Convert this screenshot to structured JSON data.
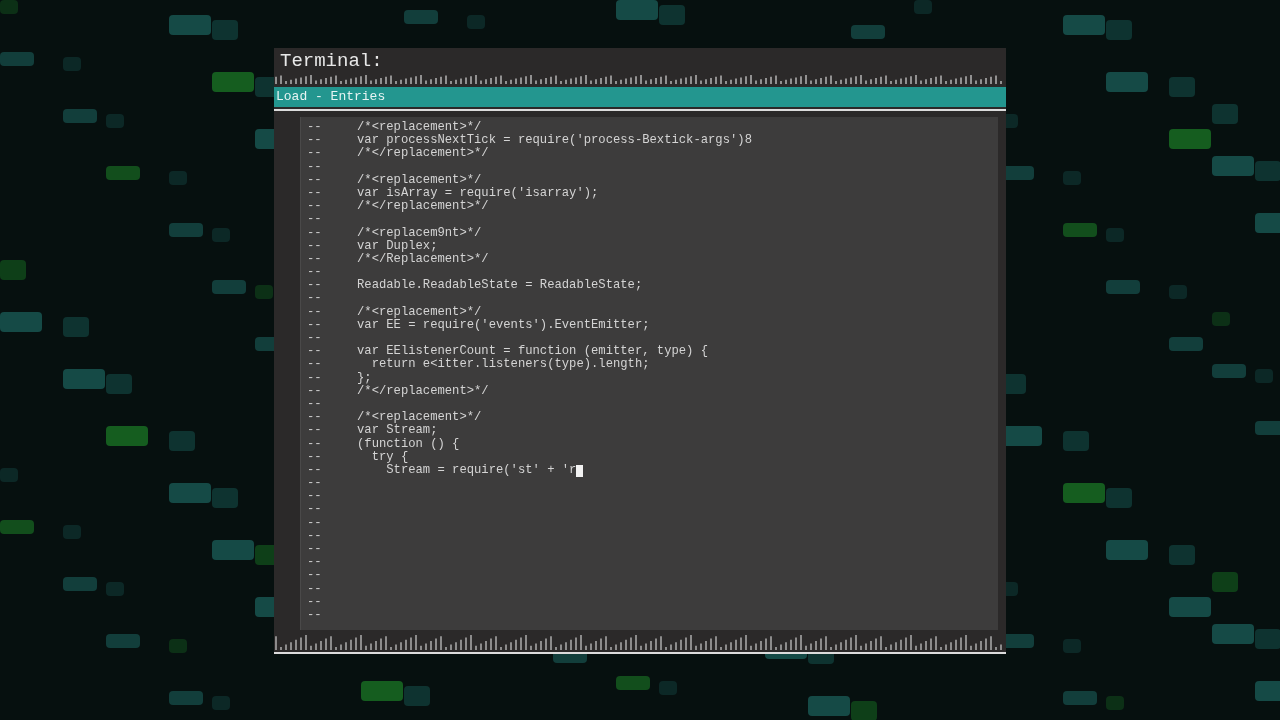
{
  "window": {
    "title": "Terminal:"
  },
  "header_bar": {
    "label": "Load - Entries"
  },
  "editor": {
    "lines": [
      {
        "marker": "--",
        "code": "/*<replacement>*/",
        "cursor": false
      },
      {
        "marker": "--",
        "code": "var processNextTick = require('process-Bextick-args')8",
        "cursor": false
      },
      {
        "marker": "--",
        "code": "/*</replacement>*/",
        "cursor": false
      },
      {
        "marker": "--",
        "cursor": false
      },
      {
        "marker": "--",
        "code": "/*<replacement>*/",
        "cursor": false
      },
      {
        "marker": "--",
        "code": "var isArray = require('isarray');",
        "cursor": false
      },
      {
        "marker": "--",
        "code": "/*</replacement>*/",
        "cursor": false
      },
      {
        "marker": "--",
        "cursor": false
      },
      {
        "marker": "--",
        "code": "/*<replacem9nt>*/",
        "cursor": false
      },
      {
        "marker": "--",
        "code": "var Duplex;",
        "cursor": false
      },
      {
        "marker": "--",
        "code": "/*</Replacement>*/",
        "cursor": false
      },
      {
        "marker": "--",
        "cursor": false
      },
      {
        "marker": "--",
        "code": "Readable.ReadableState = ReadableState;",
        "cursor": false
      },
      {
        "marker": "--",
        "cursor": false
      },
      {
        "marker": "--",
        "code": "/*<replacement>*/",
        "cursor": false
      },
      {
        "marker": "--",
        "code": "var EE = require('events').EventEmitter;",
        "cursor": false
      },
      {
        "marker": "--",
        "cursor": false
      },
      {
        "marker": "--",
        "code": "var EElistenerCount = function (emitter, type) {",
        "cursor": false
      },
      {
        "marker": "--",
        "code": "  return e<itter.listeners(type).length;",
        "cursor": false
      },
      {
        "marker": "--",
        "code": "};",
        "cursor": false
      },
      {
        "marker": "--",
        "code": "/*</replacement>*/",
        "cursor": false
      },
      {
        "marker": "--",
        "cursor": false
      },
      {
        "marker": "--",
        "code": "/*<replacement>*/",
        "cursor": false
      },
      {
        "marker": "--",
        "code": "var Stream;",
        "cursor": false
      },
      {
        "marker": "--",
        "code": "(function () {",
        "cursor": false
      },
      {
        "marker": "--",
        "code": "  try {",
        "cursor": false
      },
      {
        "marker": "--",
        "code": "    Stream = require('st' + 'r",
        "cursor": true
      },
      {
        "marker": "--",
        "cursor": false
      },
      {
        "marker": "--",
        "cursor": false
      },
      {
        "marker": "--",
        "cursor": false
      },
      {
        "marker": "--",
        "cursor": false
      },
      {
        "marker": "--",
        "cursor": false
      },
      {
        "marker": "--",
        "cursor": false
      },
      {
        "marker": "--",
        "cursor": false
      },
      {
        "marker": "--",
        "cursor": false
      },
      {
        "marker": "--",
        "cursor": false
      },
      {
        "marker": "--",
        "cursor": false
      },
      {
        "marker": "--",
        "cursor": false
      }
    ]
  }
}
